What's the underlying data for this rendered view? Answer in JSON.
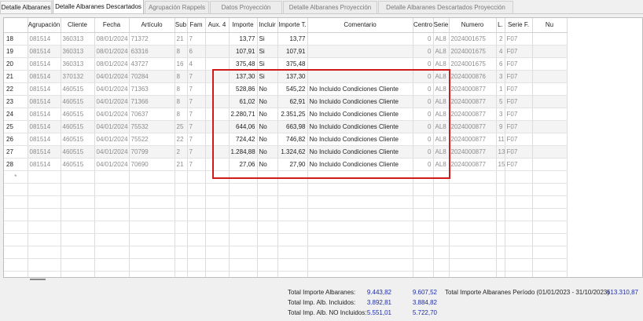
{
  "tabs": [
    {
      "label": "Detalle Albaranes",
      "w": 66
    },
    {
      "label": "Detalle Albaranes Descartados",
      "w": 116
    },
    {
      "label": "Agrupación Rappels",
      "w": 82
    },
    {
      "label": "Datos Proyección",
      "w": 92
    },
    {
      "label": "Detalle Albaranes Proyección",
      "w": 120
    },
    {
      "label": "Detalle Albaranes Descartados Proyección",
      "w": 172
    }
  ],
  "columns": [
    "",
    "Agrupación",
    "Cliente",
    "Fecha",
    "Artículo",
    "Sub",
    "Fam",
    "Aux. 4",
    "Importe",
    "Incluir",
    "Importe T.",
    "Comentario",
    "Centro",
    "Serie",
    "Numero",
    "L.",
    "Serie F.",
    "Nu"
  ],
  "rows": [
    {
      "rn": "18",
      "agr": "081514",
      "cli": "360313",
      "fecha": "08/01/2024",
      "art": "71372",
      "sub": "21",
      "fam": "7",
      "aux": "",
      "imp": "13,77",
      "inc": "Si",
      "impt": "13,77",
      "com": "",
      "centro": "0",
      "serie": "AL8",
      "numero": "2024001675",
      "l": "2",
      "serief": "F07"
    },
    {
      "rn": "19",
      "agr": "081514",
      "cli": "360313",
      "fecha": "08/01/2024",
      "art": "63316",
      "sub": "8",
      "fam": "6",
      "aux": "",
      "imp": "107,91",
      "inc": "Si",
      "impt": "107,91",
      "com": "",
      "centro": "0",
      "serie": "AL8",
      "numero": "2024001675",
      "l": "4",
      "serief": "F07"
    },
    {
      "rn": "20",
      "agr": "081514",
      "cli": "360313",
      "fecha": "08/01/2024",
      "art": "43727",
      "sub": "16",
      "fam": "4",
      "aux": "",
      "imp": "375,48",
      "inc": "Si",
      "impt": "375,48",
      "com": "",
      "centro": "0",
      "serie": "AL8",
      "numero": "2024001675",
      "l": "6",
      "serief": "F07"
    },
    {
      "rn": "21",
      "agr": "081514",
      "cli": "370132",
      "fecha": "04/01/2024",
      "art": "70284",
      "sub": "8",
      "fam": "7",
      "aux": "",
      "imp": "137,30",
      "inc": "Si",
      "impt": "137,30",
      "com": "",
      "centro": "0",
      "serie": "AL8",
      "numero": "2024000876",
      "l": "3",
      "serief": "F07"
    },
    {
      "rn": "22",
      "agr": "081514",
      "cli": "460515",
      "fecha": "04/01/2024",
      "art": "71363",
      "sub": "8",
      "fam": "7",
      "aux": "",
      "imp": "528,86",
      "inc": "No",
      "impt": "545,22",
      "com": "No Incluido Condiciones Cliente",
      "centro": "0",
      "serie": "AL8",
      "numero": "2024000877",
      "l": "1",
      "serief": "F07"
    },
    {
      "rn": "23",
      "agr": "081514",
      "cli": "460515",
      "fecha": "04/01/2024",
      "art": "71366",
      "sub": "8",
      "fam": "7",
      "aux": "",
      "imp": "61,02",
      "inc": "No",
      "impt": "62,91",
      "com": "No Incluido Condiciones Cliente",
      "centro": "0",
      "serie": "AL8",
      "numero": "2024000877",
      "l": "5",
      "serief": "F07"
    },
    {
      "rn": "24",
      "agr": "081514",
      "cli": "460515",
      "fecha": "04/01/2024",
      "art": "70637",
      "sub": "8",
      "fam": "7",
      "aux": "",
      "imp": "2.280,71",
      "inc": "No",
      "impt": "2.351,25",
      "com": "No Incluido Condiciones Cliente",
      "centro": "0",
      "serie": "AL8",
      "numero": "2024000877",
      "l": "3",
      "serief": "F07"
    },
    {
      "rn": "25",
      "agr": "081514",
      "cli": "460515",
      "fecha": "04/01/2024",
      "art": "75532",
      "sub": "25",
      "fam": "7",
      "aux": "",
      "imp": "644,06",
      "inc": "No",
      "impt": "663,98",
      "com": "No Incluido Condiciones Cliente",
      "centro": "0",
      "serie": "AL8",
      "numero": "2024000877",
      "l": "9",
      "serief": "F07"
    },
    {
      "rn": "26",
      "agr": "081514",
      "cli": "460515",
      "fecha": "04/01/2024",
      "art": "75522",
      "sub": "22",
      "fam": "7",
      "aux": "",
      "imp": "724,42",
      "inc": "No",
      "impt": "746,82",
      "com": "No Incluido Condiciones Cliente",
      "centro": "0",
      "serie": "AL8",
      "numero": "2024000877",
      "l": "11",
      "serief": "F07"
    },
    {
      "rn": "27",
      "agr": "081514",
      "cli": "460515",
      "fecha": "04/01/2024",
      "art": "70799",
      "sub": "2",
      "fam": "7",
      "aux": "",
      "imp": "1.284,88",
      "inc": "No",
      "impt": "1.324,62",
      "com": "No Incluido Condiciones Cliente",
      "centro": "0",
      "serie": "AL8",
      "numero": "2024000877",
      "l": "13",
      "serief": "F07"
    },
    {
      "rn": "28",
      "agr": "081514",
      "cli": "460515",
      "fecha": "04/01/2024",
      "art": "70690",
      "sub": "21",
      "fam": "7",
      "aux": "",
      "imp": "27,06",
      "inc": "No",
      "impt": "27,90",
      "com": "No Incluido Condiciones Cliente",
      "centro": "0",
      "serie": "AL8",
      "numero": "2024000877",
      "l": "15",
      "serief": "F07"
    }
  ],
  "new_row_marker": "*",
  "totals": {
    "total_albaranes_label": "Total Importe Albaranes:",
    "total_albaranes_v1": "9.443,82",
    "total_albaranes_v2": "9.607,52",
    "periodo_label": "Total Importe Albaranes Período (01/01/2023 - 31/10/2023)",
    "periodo_value": "613.310,87",
    "incluidos_label": "Total Imp. Alb. Incluidos:",
    "incluidos_v1": "3.892,81",
    "incluidos_v2": "3.884,82",
    "no_incluidos_label": "Total Imp. Alb. NO Incluidos:",
    "no_incluidos_v1": "5.551,01",
    "no_incluidos_v2": "5.722,70"
  },
  "colors": {
    "highlight": "#d11a1a",
    "total_value": "#1f2ea8"
  }
}
